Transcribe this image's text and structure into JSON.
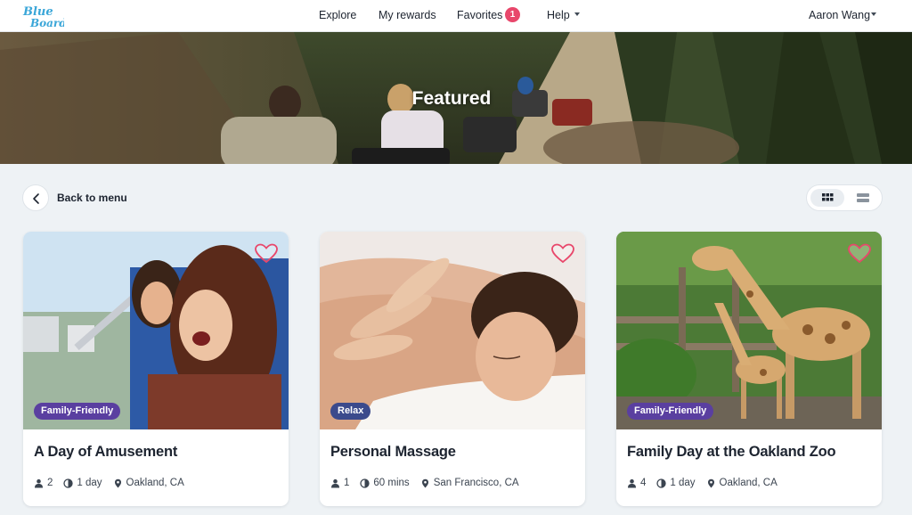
{
  "nav": {
    "logo_alt": "Blue Board",
    "logo_line1": "Blue",
    "logo_line2": "Board",
    "explore": "Explore",
    "rewards": "My rewards",
    "favorites": "Favorites",
    "favorites_count": "1",
    "help": "Help",
    "user": "Aaron Wang"
  },
  "hero": {
    "title": "Featured"
  },
  "toolbar": {
    "back_label": "Back to menu",
    "view_mode": "grid"
  },
  "colors": {
    "accent": "#3aa6d8",
    "badge": "#e8476b",
    "heart": "#e8476b",
    "tag": "#5a3fa0"
  },
  "cards": [
    {
      "title": "A Day of Amusement",
      "tag": "Family-Friendly",
      "people": "2",
      "duration": "1 day",
      "location": "Oakland, CA",
      "favorited": false
    },
    {
      "title": "Personal Massage",
      "tag": "Relax",
      "people": "1",
      "duration": "60 mins",
      "location": "San Francisco, CA",
      "favorited": false
    },
    {
      "title": "Family Day at the Oakland Zoo",
      "tag": "Family-Friendly",
      "people": "4",
      "duration": "1 day",
      "location": "Oakland, CA",
      "favorited": false
    }
  ]
}
